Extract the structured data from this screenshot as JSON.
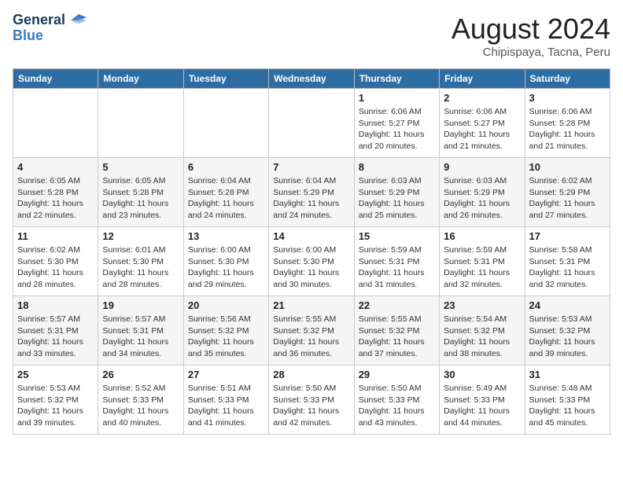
{
  "header": {
    "logo_line1": "General",
    "logo_line2": "Blue",
    "month": "August 2024",
    "location": "Chipispaya, Tacna, Peru"
  },
  "weekdays": [
    "Sunday",
    "Monday",
    "Tuesday",
    "Wednesday",
    "Thursday",
    "Friday",
    "Saturday"
  ],
  "weeks": [
    [
      {
        "day": "",
        "info": ""
      },
      {
        "day": "",
        "info": ""
      },
      {
        "day": "",
        "info": ""
      },
      {
        "day": "",
        "info": ""
      },
      {
        "day": "1",
        "info": "Sunrise: 6:06 AM\nSunset: 5:27 PM\nDaylight: 11 hours\nand 20 minutes."
      },
      {
        "day": "2",
        "info": "Sunrise: 6:06 AM\nSunset: 5:27 PM\nDaylight: 11 hours\nand 21 minutes."
      },
      {
        "day": "3",
        "info": "Sunrise: 6:06 AM\nSunset: 5:28 PM\nDaylight: 11 hours\nand 21 minutes."
      }
    ],
    [
      {
        "day": "4",
        "info": "Sunrise: 6:05 AM\nSunset: 5:28 PM\nDaylight: 11 hours\nand 22 minutes."
      },
      {
        "day": "5",
        "info": "Sunrise: 6:05 AM\nSunset: 5:28 PM\nDaylight: 11 hours\nand 23 minutes."
      },
      {
        "day": "6",
        "info": "Sunrise: 6:04 AM\nSunset: 5:28 PM\nDaylight: 11 hours\nand 24 minutes."
      },
      {
        "day": "7",
        "info": "Sunrise: 6:04 AM\nSunset: 5:29 PM\nDaylight: 11 hours\nand 24 minutes."
      },
      {
        "day": "8",
        "info": "Sunrise: 6:03 AM\nSunset: 5:29 PM\nDaylight: 11 hours\nand 25 minutes."
      },
      {
        "day": "9",
        "info": "Sunrise: 6:03 AM\nSunset: 5:29 PM\nDaylight: 11 hours\nand 26 minutes."
      },
      {
        "day": "10",
        "info": "Sunrise: 6:02 AM\nSunset: 5:29 PM\nDaylight: 11 hours\nand 27 minutes."
      }
    ],
    [
      {
        "day": "11",
        "info": "Sunrise: 6:02 AM\nSunset: 5:30 PM\nDaylight: 11 hours\nand 28 minutes."
      },
      {
        "day": "12",
        "info": "Sunrise: 6:01 AM\nSunset: 5:30 PM\nDaylight: 11 hours\nand 28 minutes."
      },
      {
        "day": "13",
        "info": "Sunrise: 6:00 AM\nSunset: 5:30 PM\nDaylight: 11 hours\nand 29 minutes."
      },
      {
        "day": "14",
        "info": "Sunrise: 6:00 AM\nSunset: 5:30 PM\nDaylight: 11 hours\nand 30 minutes."
      },
      {
        "day": "15",
        "info": "Sunrise: 5:59 AM\nSunset: 5:31 PM\nDaylight: 11 hours\nand 31 minutes."
      },
      {
        "day": "16",
        "info": "Sunrise: 5:59 AM\nSunset: 5:31 PM\nDaylight: 11 hours\nand 32 minutes."
      },
      {
        "day": "17",
        "info": "Sunrise: 5:58 AM\nSunset: 5:31 PM\nDaylight: 11 hours\nand 32 minutes."
      }
    ],
    [
      {
        "day": "18",
        "info": "Sunrise: 5:57 AM\nSunset: 5:31 PM\nDaylight: 11 hours\nand 33 minutes."
      },
      {
        "day": "19",
        "info": "Sunrise: 5:57 AM\nSunset: 5:31 PM\nDaylight: 11 hours\nand 34 minutes."
      },
      {
        "day": "20",
        "info": "Sunrise: 5:56 AM\nSunset: 5:32 PM\nDaylight: 11 hours\nand 35 minutes."
      },
      {
        "day": "21",
        "info": "Sunrise: 5:55 AM\nSunset: 5:32 PM\nDaylight: 11 hours\nand 36 minutes."
      },
      {
        "day": "22",
        "info": "Sunrise: 5:55 AM\nSunset: 5:32 PM\nDaylight: 11 hours\nand 37 minutes."
      },
      {
        "day": "23",
        "info": "Sunrise: 5:54 AM\nSunset: 5:32 PM\nDaylight: 11 hours\nand 38 minutes."
      },
      {
        "day": "24",
        "info": "Sunrise: 5:53 AM\nSunset: 5:32 PM\nDaylight: 11 hours\nand 39 minutes."
      }
    ],
    [
      {
        "day": "25",
        "info": "Sunrise: 5:53 AM\nSunset: 5:32 PM\nDaylight: 11 hours\nand 39 minutes."
      },
      {
        "day": "26",
        "info": "Sunrise: 5:52 AM\nSunset: 5:33 PM\nDaylight: 11 hours\nand 40 minutes."
      },
      {
        "day": "27",
        "info": "Sunrise: 5:51 AM\nSunset: 5:33 PM\nDaylight: 11 hours\nand 41 minutes."
      },
      {
        "day": "28",
        "info": "Sunrise: 5:50 AM\nSunset: 5:33 PM\nDaylight: 11 hours\nand 42 minutes."
      },
      {
        "day": "29",
        "info": "Sunrise: 5:50 AM\nSunset: 5:33 PM\nDaylight: 11 hours\nand 43 minutes."
      },
      {
        "day": "30",
        "info": "Sunrise: 5:49 AM\nSunset: 5:33 PM\nDaylight: 11 hours\nand 44 minutes."
      },
      {
        "day": "31",
        "info": "Sunrise: 5:48 AM\nSunset: 5:33 PM\nDaylight: 11 hours\nand 45 minutes."
      }
    ]
  ]
}
